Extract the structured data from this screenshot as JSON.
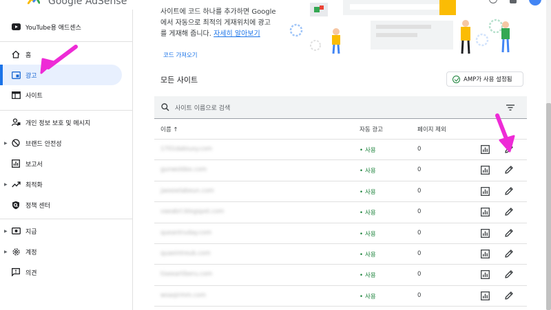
{
  "header": {
    "logo_text": "Google AdSense"
  },
  "sidebar": {
    "items": [
      {
        "label": "YouTube용 애드센스",
        "icon": "youtube-icon"
      },
      {
        "label": "홈",
        "icon": "home-icon"
      },
      {
        "label": "광고",
        "icon": "ads-icon",
        "active": true
      },
      {
        "label": "사이트",
        "icon": "sites-icon"
      },
      {
        "label": "개인 정보 보호 및 메시지",
        "icon": "privacy-icon"
      },
      {
        "label": "브랜드 안전성",
        "icon": "brand-safety-icon"
      },
      {
        "label": "보고서",
        "icon": "reports-icon"
      },
      {
        "label": "최적화",
        "icon": "optimization-icon"
      },
      {
        "label": "정책 센터",
        "icon": "policy-icon"
      },
      {
        "label": "지급",
        "icon": "payments-icon"
      },
      {
        "label": "계정",
        "icon": "account-icon"
      },
      {
        "label": "의견",
        "icon": "feedback-icon"
      }
    ]
  },
  "intro": {
    "line1": "사이트에 코드 하나를 추가하면 Google",
    "line2": "에서 자동으로 최적의 게재위치에 광고",
    "line3_prefix": "를 게재해 줍니다. ",
    "learn_more": "자세히 알아보기",
    "code_link": "코드 가져오기"
  },
  "sites": {
    "title": "모든 사이트",
    "amp_button": "AMP가 사용 설정됨",
    "search_placeholder": "사이트 이름으로 검색",
    "columns": {
      "name": "이름 ↑",
      "auto_ads": "자동 광고",
      "page_exclusions": "페이지 제외"
    },
    "rows": [
      {
        "site": "1701dabiuxy.com",
        "status": "사용",
        "exclusions": "0"
      },
      {
        "site": "gunwoldex.com",
        "status": "사용",
        "exclusions": "0"
      },
      {
        "site": "jaexoelabeun.com",
        "status": "사용",
        "exclusions": "0"
      },
      {
        "site": "vaeabrl.blogspot.com",
        "status": "사용",
        "exclusions": "0"
      },
      {
        "site": "queantruday.com",
        "status": "사용",
        "exclusions": "0"
      },
      {
        "site": "quaeintreub.com",
        "status": "사용",
        "exclusions": "0"
      },
      {
        "site": "tiseeartiberu.com",
        "status": "사용",
        "exclusions": "0"
      },
      {
        "site": "woaqirmm.com",
        "status": "사용",
        "exclusions": "0"
      }
    ]
  },
  "colors": {
    "accent": "#1a73e8",
    "active_bg": "#e8f0fe",
    "status_green": "#188038",
    "annotation_arrow": "#ee2bd6"
  }
}
